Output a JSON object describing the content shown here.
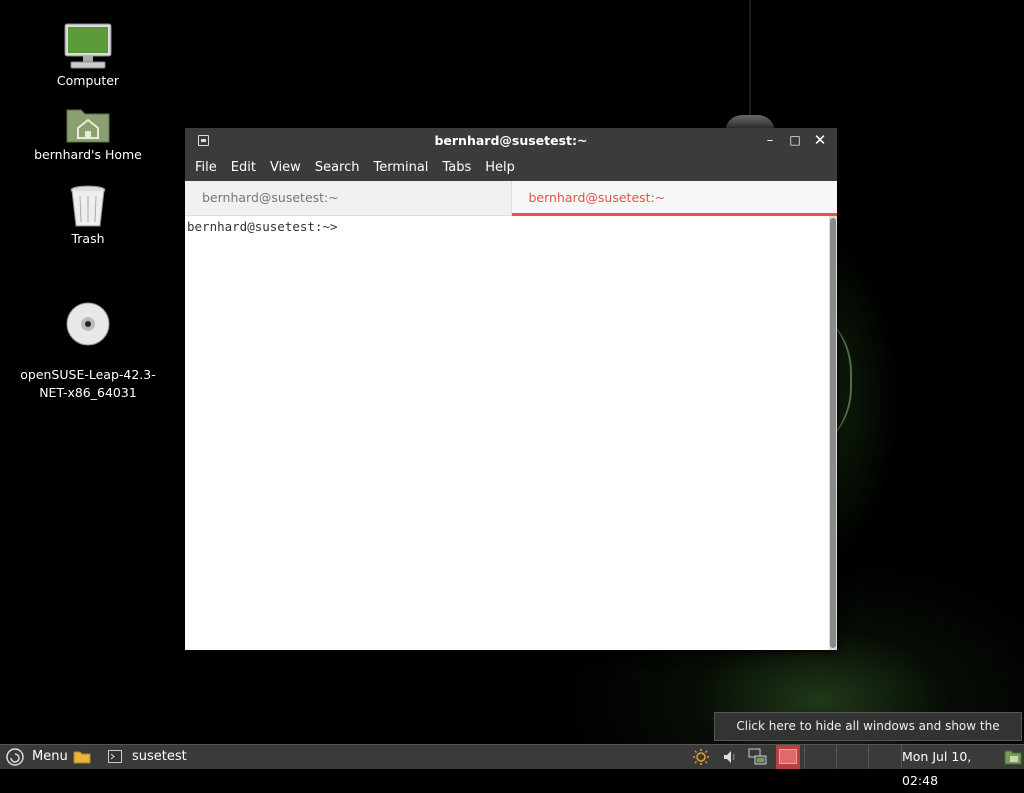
{
  "desktop": {
    "icons": [
      {
        "label": "Computer"
      },
      {
        "label": "bernhard's Home"
      },
      {
        "label": "Trash"
      },
      {
        "label": "openSUSE-Leap-42.3-\nNET-x86_64031"
      }
    ]
  },
  "window": {
    "title": "bernhard@susetest:~",
    "menu": [
      "File",
      "Edit",
      "View",
      "Search",
      "Terminal",
      "Tabs",
      "Help"
    ],
    "tabs": [
      {
        "label": "bernhard@susetest:~",
        "active": false
      },
      {
        "label": "bernhard@susetest:~",
        "active": true
      }
    ],
    "prompt": "bernhard@susetest:~>"
  },
  "tooltip": "Click here to hide all windows and show the desktop.",
  "panel": {
    "menu_label": "Menu",
    "task_label": "susetest",
    "clock": "Mon Jul 10, 02:48",
    "icons": [
      "mint-menu-icon",
      "folder-icon",
      "terminal-icon",
      "brightness-icon",
      "volume-icon",
      "network-icon",
      "workspace-icon",
      "show-desktop-icon"
    ]
  },
  "colors": {
    "accent": "#e0534f",
    "titlebar": "#3b3b3b",
    "panel": "#3a3a3a"
  }
}
